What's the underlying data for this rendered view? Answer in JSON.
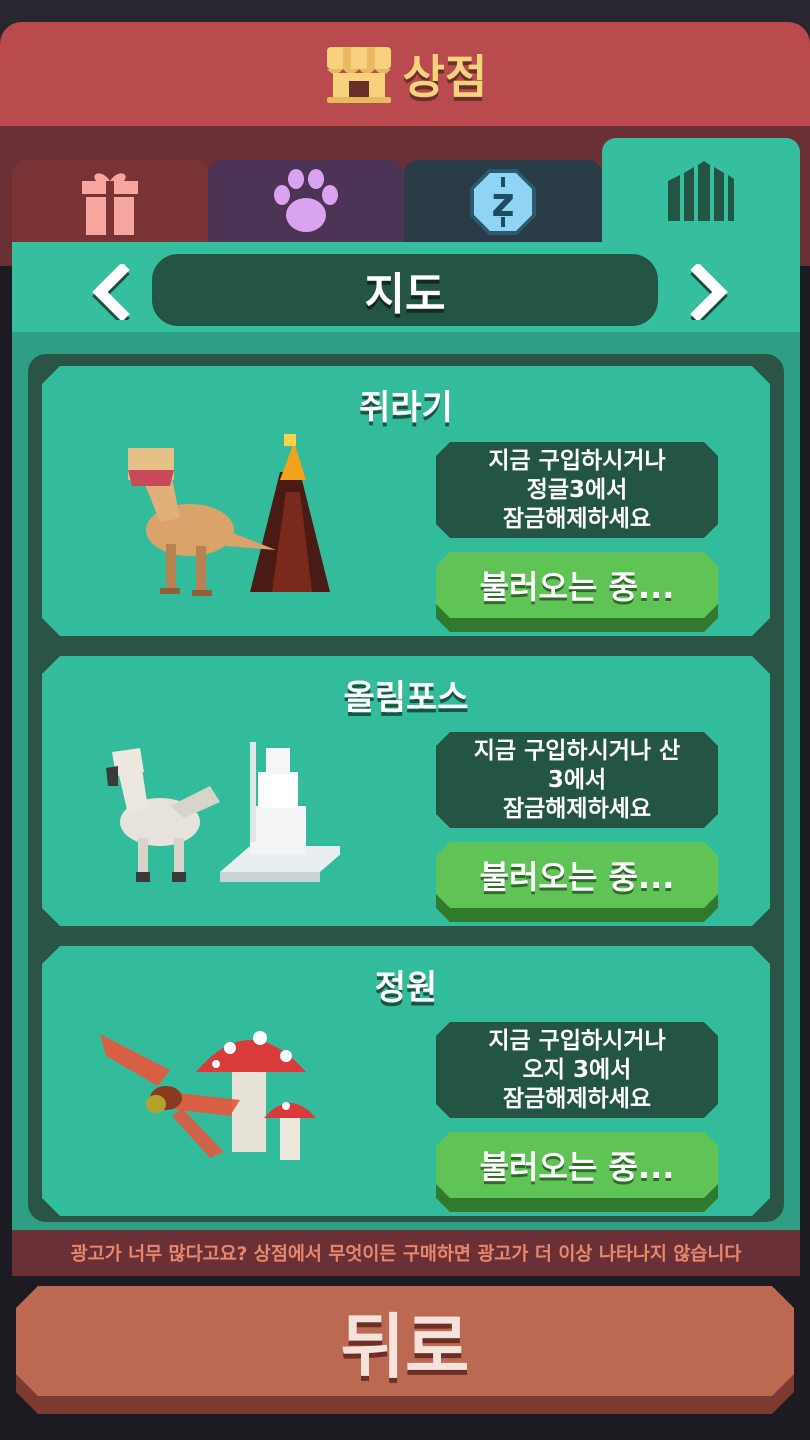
{
  "header": {
    "title": "상점",
    "icon": "shop-stall-icon"
  },
  "tabs": [
    {
      "name": "gift",
      "icon": "gift-icon",
      "color": "#7a3335"
    },
    {
      "name": "pets",
      "icon": "paw-icon",
      "color": "#4d3456"
    },
    {
      "name": "coins",
      "icon": "coin-icon",
      "color": "#293b46"
    },
    {
      "name": "maps",
      "icon": "map-icon",
      "color": "#36bf9f",
      "selected": true
    }
  ],
  "category": {
    "label": "지도",
    "prev_icon": "chevron-left-icon",
    "next_icon": "chevron-right-icon"
  },
  "items": [
    {
      "title": "쥐라기",
      "description": "지금 구입하시거나\n정글3에서\n잠금해제하세요",
      "button": "불러오는 중..."
    },
    {
      "title": "올림포스",
      "description": "지금 구입하시거나 산\n3에서\n잠금해제하세요",
      "button": "불러오는 중..."
    },
    {
      "title": "정원",
      "description": "지금 구입하시거나\n오지 3에서\n잠금해제하세요",
      "button": "불러오는 중..."
    }
  ],
  "notice": "광고가 너무 많다고요? 상점에서 무엇이든 구매하면 광고가 더 이상 나타나지 않습니다",
  "back_button": "뒤로",
  "colors": {
    "header": "#b94a4d",
    "panel": "#36bf9f",
    "button": "#5fc455",
    "back": "#bb6952"
  }
}
